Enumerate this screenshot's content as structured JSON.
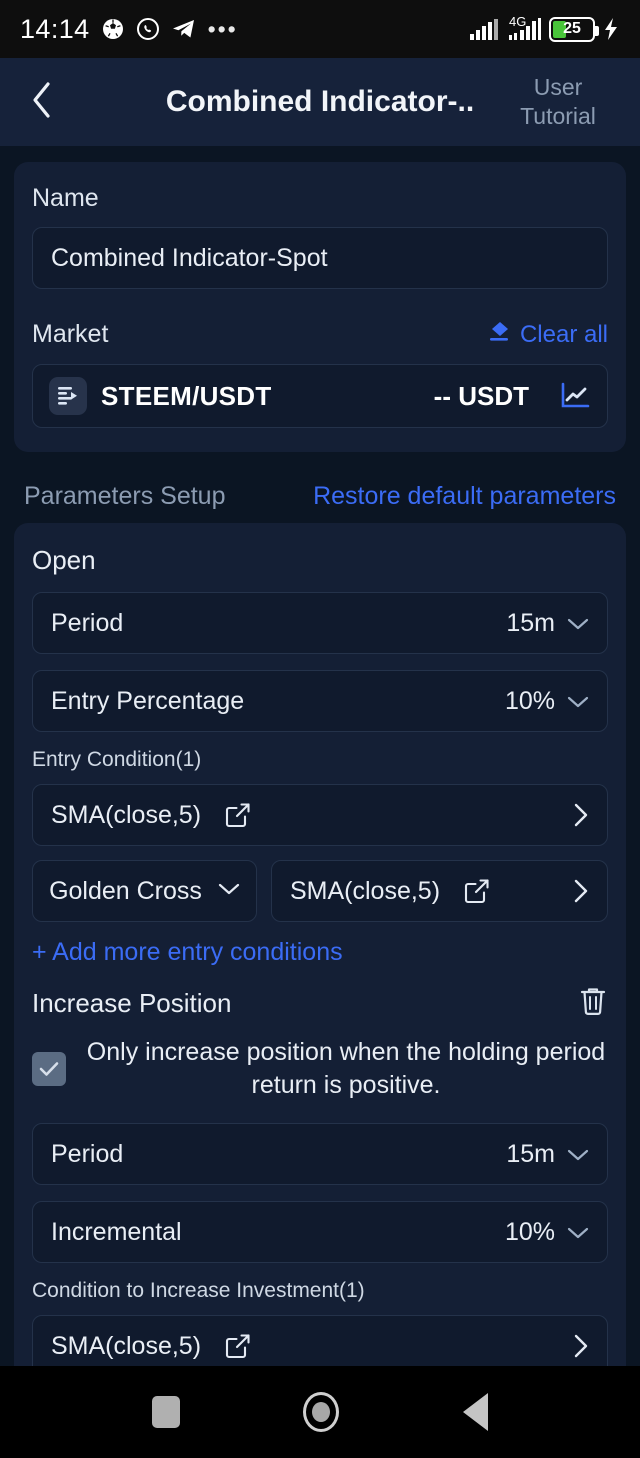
{
  "status_bar": {
    "time": "14:14",
    "app_icons": [
      "soccer-ball-icon",
      "whatsapp-icon",
      "telegram-icon",
      "more-dots-icon"
    ],
    "network_label": "4G",
    "battery_level": "25",
    "charging": true,
    "battery_color": "#49c43a"
  },
  "header": {
    "back_icon": "chevron-left-icon",
    "title": "Combined Indicator-..",
    "tutorial_line1": "User",
    "tutorial_line2": "Tutorial"
  },
  "basic_card": {
    "name_label": "Name",
    "name_value": "Combined Indicator-Spot",
    "market_label": "Market",
    "clear_all": "Clear all",
    "clear_icon": "eraser-icon",
    "market_icon": "spot-market-icon",
    "market_pair": "STEEM/USDT",
    "market_price": "-- USDT",
    "chart_icon": "line-chart-icon"
  },
  "parameters": {
    "section_title": "Parameters Setup",
    "restore_label": "Restore default parameters",
    "open_title": "Open",
    "open_rows": [
      {
        "label": "Period",
        "value": "15m"
      },
      {
        "label": "Entry Percentage",
        "value": "10%"
      }
    ],
    "entry_condition_label": "Entry Condition(1)",
    "entry_first": "SMA(close,5)",
    "entry_operator": "Golden Cross",
    "entry_second": "SMA(close,5)",
    "add_more": "+ Add more entry conditions"
  },
  "increase_position": {
    "title": "Increase Position",
    "delete_icon": "trash-icon",
    "checkbox_checked": true,
    "checkbox_text": "Only increase position when the holding period return is positive.",
    "rows": [
      {
        "label": "Period",
        "value": "15m"
      },
      {
        "label": "Incremental",
        "value": "10%"
      }
    ],
    "condition_label": "Condition to Increase Investment(1)",
    "condition_first": "SMA(close,5)"
  },
  "nav_bar": {
    "recents_icon": "square-recents-icon",
    "home_icon": "circle-home-icon",
    "back_icon": "triangle-back-icon"
  },
  "colors": {
    "page_bg": "#0b1523",
    "card_bg": "#141f35",
    "field_bg": "#101a2d",
    "accent_blue": "#3b6cf5",
    "muted_text": "#8c9cb2"
  }
}
